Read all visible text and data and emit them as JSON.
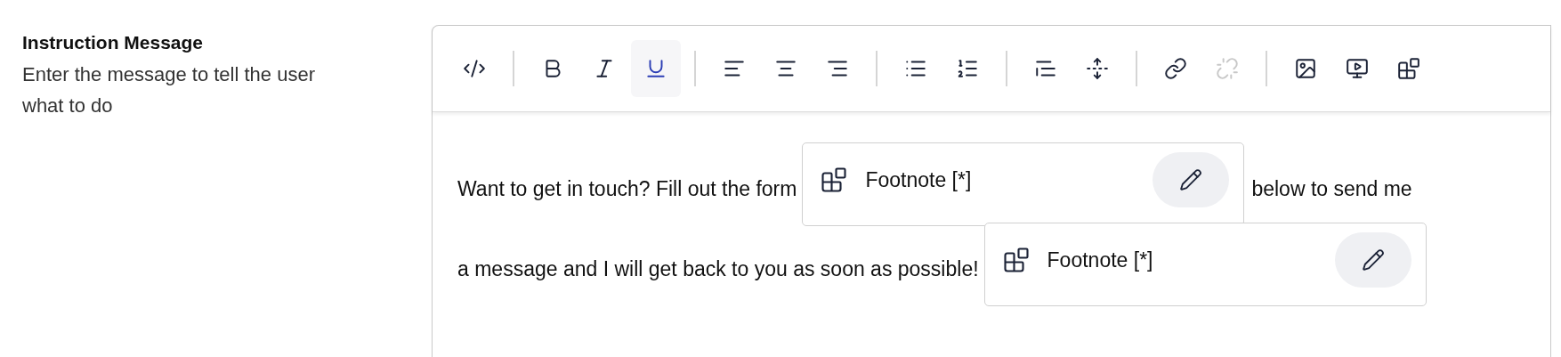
{
  "field": {
    "label": "Instruction Message",
    "description": "Enter the message to tell the user what to do"
  },
  "toolbar": [
    [
      {
        "kind": "code",
        "active": false,
        "disabled": false
      }
    ],
    [
      {
        "kind": "bold",
        "active": false,
        "disabled": false
      },
      {
        "kind": "italic",
        "active": false,
        "disabled": false
      },
      {
        "kind": "underline",
        "active": true,
        "disabled": false
      }
    ],
    [
      {
        "kind": "alignleft",
        "active": false,
        "disabled": false
      },
      {
        "kind": "aligncenter",
        "active": false,
        "disabled": false
      },
      {
        "kind": "alignright",
        "active": false,
        "disabled": false
      }
    ],
    [
      {
        "kind": "bullets",
        "active": false,
        "disabled": false
      },
      {
        "kind": "numbers",
        "active": false,
        "disabled": false
      }
    ],
    [
      {
        "kind": "quote",
        "active": false,
        "disabled": false
      },
      {
        "kind": "divider",
        "active": false,
        "disabled": false
      }
    ],
    [
      {
        "kind": "link",
        "active": false,
        "disabled": false
      },
      {
        "kind": "unlink",
        "active": false,
        "disabled": true
      }
    ],
    [
      {
        "kind": "image",
        "active": false,
        "disabled": false
      },
      {
        "kind": "video",
        "active": false,
        "disabled": false
      },
      {
        "kind": "widget",
        "active": false,
        "disabled": false
      }
    ]
  ],
  "content": {
    "lines": [
      [
        {
          "kind": "text",
          "text": "Want to get in touch? Fill out the form"
        },
        {
          "kind": "footnote",
          "label": "Footnote [*]"
        },
        {
          "kind": "text",
          "text": "below to send me"
        }
      ],
      [
        {
          "kind": "text",
          "text": "a message and I will get back to you as soon as possible!"
        },
        {
          "kind": "footnote",
          "label": "Footnote [*]"
        }
      ]
    ]
  }
}
